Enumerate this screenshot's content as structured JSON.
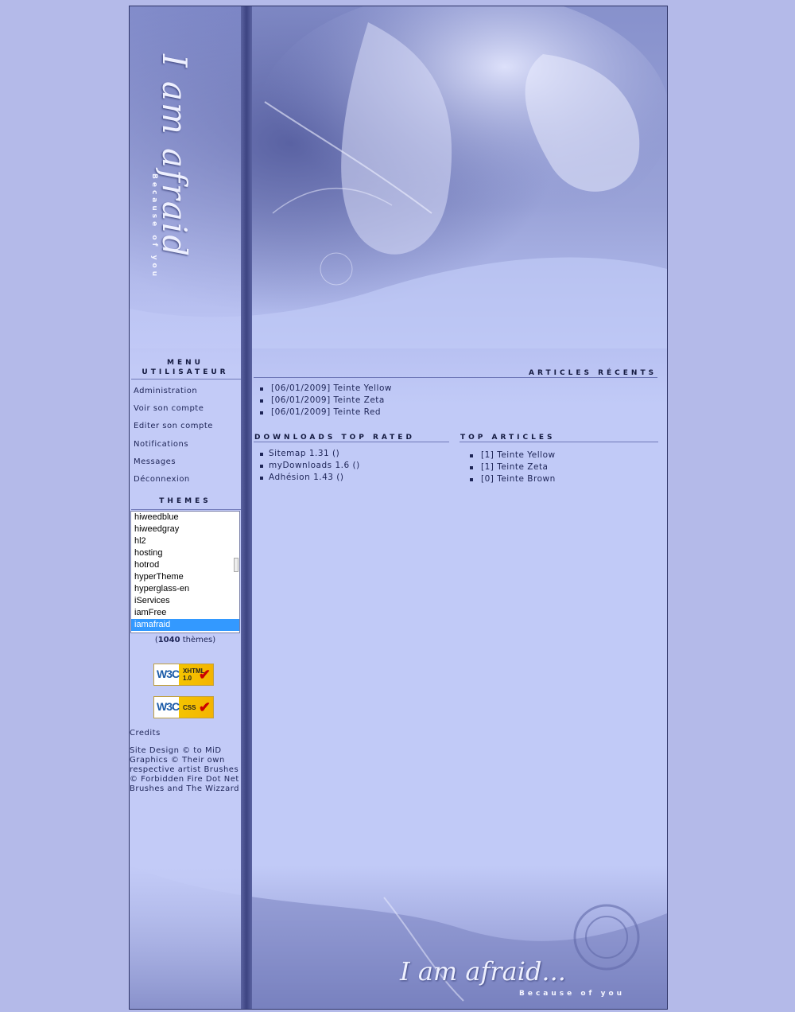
{
  "branding": {
    "logo_text": "I am afraid",
    "tagline": "Because of you",
    "footer_logo_text": "I am afraid...",
    "footer_tagline": "Because of you"
  },
  "user_menu": {
    "title": "Menu utilisateur",
    "items": [
      {
        "label": "Administration"
      },
      {
        "label": "Voir son compte"
      },
      {
        "label": "Editer son compte"
      },
      {
        "label": "Notifications"
      },
      {
        "label": "Messages"
      },
      {
        "label": "Déconnexion"
      }
    ]
  },
  "themes": {
    "title": "Themes",
    "options": [
      "hiweedblue",
      "hiweedgray",
      "hl2",
      "hosting",
      "hotrod",
      "hyperTheme",
      "hyperglass-en",
      "iServices",
      "iamFree",
      "iamafraid"
    ],
    "selected": "iamafraid",
    "count_open": "(",
    "count_number": "1040",
    "count_suffix": " thèmes)"
  },
  "badges": {
    "xhtml": {
      "logo": "W3C",
      "line1": "XHTML",
      "line2": "1.0"
    },
    "css": {
      "logo": "W3C",
      "line1": "CSS"
    }
  },
  "credits": {
    "title": "Credits",
    "text": "Site Design © to MiD Graphics © Their own respective artist Brushes © Forbidden Fire Dot Net Brushes and The Wizzard"
  },
  "recent_articles": {
    "title": "Articles récents",
    "items": [
      "[06/01/2009] Teinte Yellow",
      "[06/01/2009] Teinte Zeta",
      "[06/01/2009] Teinte Red"
    ]
  },
  "downloads_top_rated": {
    "title": "Downloads top Rated",
    "items": [
      "Sitemap 1.31 ()",
      "myDownloads 1.6 ()",
      "Adhésion 1.43 ()"
    ]
  },
  "top_articles": {
    "title": "Top articles",
    "items": [
      "[1] Teinte Yellow",
      "[1] Teinte Zeta",
      "[0] Teinte Brown"
    ]
  },
  "colors": {
    "page_background": "#b4bae9",
    "content_background": "#c1caf7",
    "text": "#1d2456",
    "selected_option": "#3399ff"
  }
}
